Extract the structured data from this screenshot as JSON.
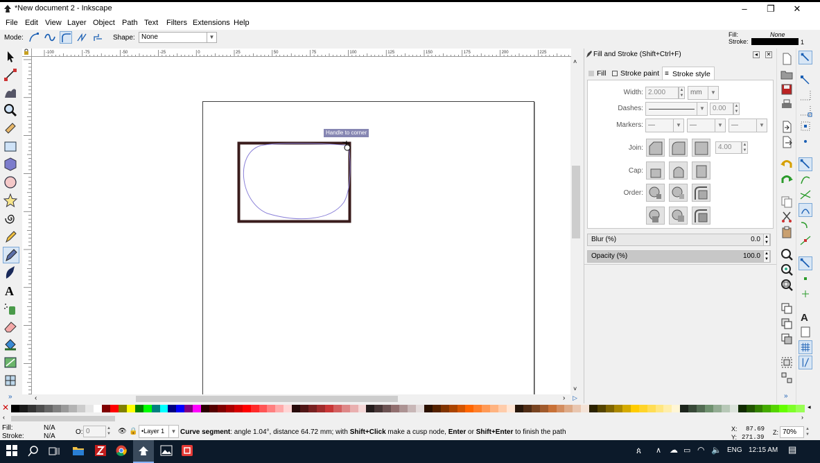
{
  "window": {
    "title": "*New document 2 - Inkscape",
    "minimize": "–",
    "maximize": "❐",
    "close": "✕"
  },
  "menu": [
    "File",
    "Edit",
    "View",
    "Layer",
    "Object",
    "Path",
    "Text",
    "Filters",
    "Extensions",
    "Help"
  ],
  "toolbar": {
    "mode_label": "Mode:",
    "shape_label": "Shape:",
    "shape_value": "None",
    "fill_label": "Fill:",
    "fill_value": "None",
    "stroke_label": "Stroke:",
    "stroke_width": "1"
  },
  "ruler": {
    "ticks": [
      "-100",
      "-75",
      "-50",
      "-25",
      "0",
      "25",
      "50",
      "75",
      "100",
      "125",
      "150",
      "175",
      "200",
      "225"
    ]
  },
  "canvas": {
    "tooltip": "Handle to corner",
    "rect_stroke": "#3a1c1c",
    "path_color": "#8a80d8"
  },
  "dialog": {
    "title": "Fill and Stroke (Shift+Ctrl+F)",
    "tabs": [
      "Fill",
      "Stroke paint",
      "Stroke style"
    ],
    "width_label": "Width:",
    "width_value": "2.000",
    "unit_value": "mm",
    "dashes_label": "Dashes:",
    "dash_offset": "0.00",
    "markers_label": "Markers:",
    "join_label": "Join:",
    "miter_limit": "4.00",
    "cap_label": "Cap:",
    "order_label": "Order:",
    "blur_label": "Blur (%)",
    "blur_value": "0.0",
    "opacity_label": "Opacity (%)",
    "opacity_value": "100.0"
  },
  "status": {
    "fill_label": "Fill:",
    "fill_value": "N/A",
    "stroke_label": "Stroke:",
    "stroke_value": "N/A",
    "opacity_label": "O:",
    "opacity_value": "0",
    "layer_value": "•Layer 1",
    "message_bold": "Curve segment",
    "message_1": ": angle 1.04°, distance 64.72 mm; with ",
    "message_bold2": "Shift+Click",
    "message_2": " make a cusp node, ",
    "message_bold3": "Enter",
    "message_3": " or ",
    "message_bold4": "Shift+Enter",
    "message_4": " to finish the path",
    "x_label": "X:",
    "x_value": "87.69",
    "y_label": "Y:",
    "y_value": "271.39",
    "zoom_label": "Z:",
    "zoom_value": "70%"
  },
  "taskbar": {
    "lang": "ENG",
    "time": "12:15 AM"
  },
  "palette": [
    "#000000",
    "#1a1a1a",
    "#333333",
    "#4d4d4d",
    "#666666",
    "#808080",
    "#999999",
    "#b3b3b3",
    "#cccccc",
    "#e6e6e6",
    "#ffffff",
    "#800000",
    "#ff0000",
    "#808000",
    "#ffff00",
    "#008000",
    "#00ff00",
    "#008080",
    "#00ffff",
    "#000080",
    "#0000ff",
    "#800080",
    "#ff00ff",
    "#2b0000",
    "#550000",
    "#800000",
    "#aa0000",
    "#d40000",
    "#ff0000",
    "#ff2a2a",
    "#ff5555",
    "#ff8080",
    "#ffaaaa",
    "#ffd5d5",
    "#280b0b",
    "#501616",
    "#782121",
    "#a02c2c",
    "#c83737",
    "#d35f5f",
    "#de8787",
    "#e9afaf",
    "#f4d7d7",
    "#241c1c",
    "#483737",
    "#6c5353",
    "#916f6f",
    "#ac9393",
    "#c8b7b7",
    "#e3dbdb",
    "#2b1100",
    "#552200",
    "#803300",
    "#aa4400",
    "#d45500",
    "#ff6600",
    "#ff7f2a",
    "#ff9955",
    "#ffb380",
    "#ffccaa",
    "#ffe6d5",
    "#28170b",
    "#502d16",
    "#784421",
    "#a05a2c",
    "#c87137",
    "#d38d5f",
    "#deaa87",
    "#e9c6af",
    "#f4e3d7",
    "#2b2200",
    "#554400",
    "#806600",
    "#aa8800",
    "#d4aa00",
    "#ffcc00",
    "#ffd42a",
    "#ffdd55",
    "#ffe680",
    "#ffeeaa",
    "#fff6d5",
    "#1c241c",
    "#374837",
    "#536c53",
    "#6f916f",
    "#93ac93",
    "#b7c8b7",
    "#dbe3db",
    "#112b00",
    "#225500",
    "#338000",
    "#44aa00",
    "#55d400",
    "#66ff00",
    "#7fff2a",
    "#99ff55"
  ]
}
